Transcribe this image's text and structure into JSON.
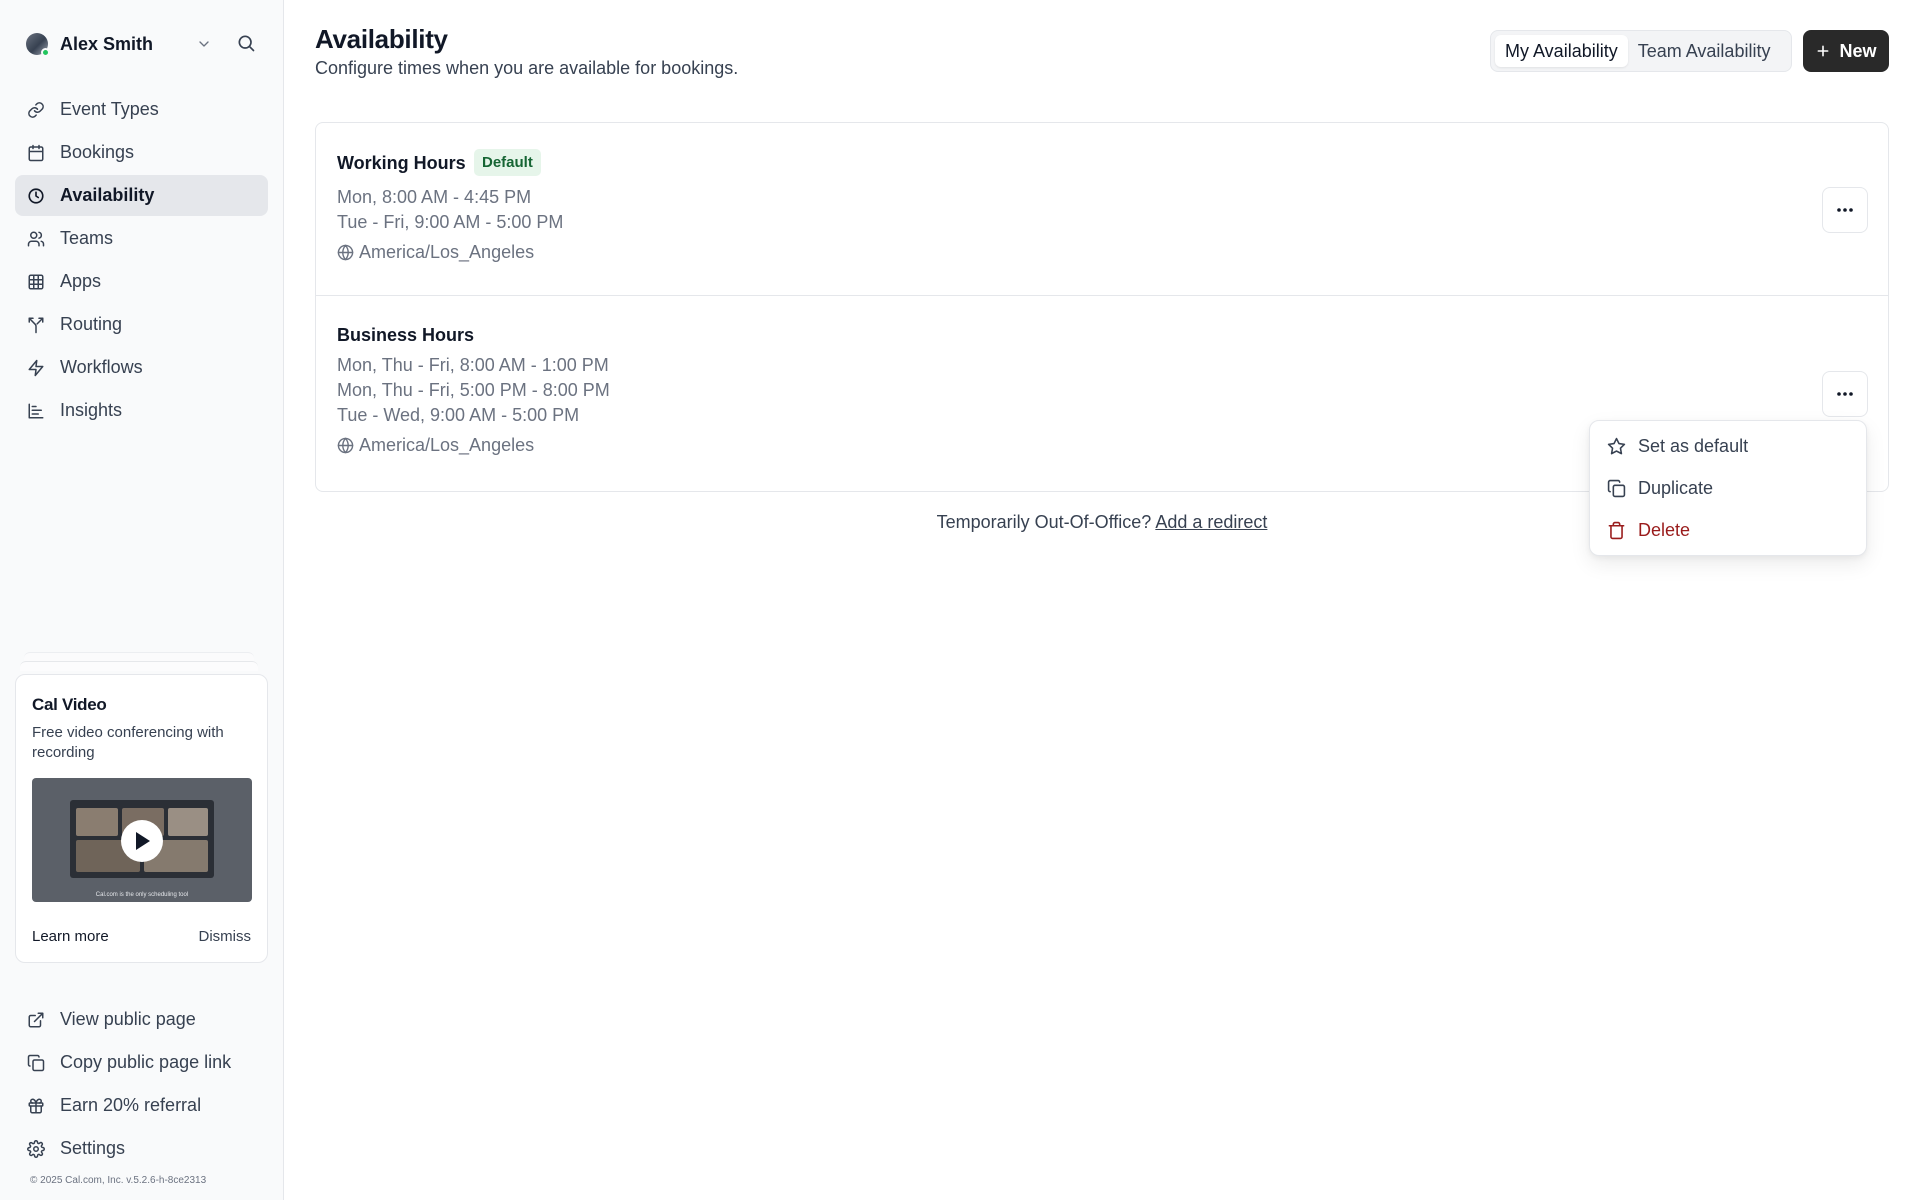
{
  "sidebar": {
    "user": {
      "name": "Alex Smith"
    },
    "nav": [
      {
        "label": "Event Types",
        "icon": "link-icon"
      },
      {
        "label": "Bookings",
        "icon": "calendar-icon"
      },
      {
        "label": "Availability",
        "icon": "clock-icon",
        "active": true
      },
      {
        "label": "Teams",
        "icon": "users-icon"
      },
      {
        "label": "Apps",
        "icon": "grid-icon"
      },
      {
        "label": "Routing",
        "icon": "split-icon"
      },
      {
        "label": "Workflows",
        "icon": "zap-icon"
      },
      {
        "label": "Insights",
        "icon": "bar-chart-icon"
      }
    ],
    "promo": {
      "brand": "Cal Video",
      "description": "Free video conferencing with recording",
      "video_caption": "Cal.com is the only scheduling tool",
      "learn_more": "Learn more",
      "dismiss": "Dismiss"
    },
    "bottom_nav": [
      {
        "label": "View public page",
        "icon": "external-link-icon"
      },
      {
        "label": "Copy public page link",
        "icon": "copy-icon"
      },
      {
        "label": "Earn 20% referral",
        "icon": "gift-icon"
      },
      {
        "label": "Settings",
        "icon": "gear-icon"
      }
    ],
    "copyright": "© 2025 Cal.com, Inc. v.5.2.6-h-8ce2313"
  },
  "header": {
    "title": "Availability",
    "subtitle": "Configure times when you are available for bookings.",
    "toggle": {
      "my": "My Availability",
      "team": "Team Availability",
      "selected": "My Availability"
    },
    "new_label": "New"
  },
  "schedules": [
    {
      "name": "Working Hours",
      "badge": "Default",
      "lines": [
        "Mon, 8:00 AM - 4:45 PM",
        "Tue - Fri, 9:00 AM - 5:00 PM"
      ],
      "timezone": "America/Los_Angeles"
    },
    {
      "name": "Business Hours",
      "lines": [
        "Mon, Thu - Fri, 8:00 AM - 1:00 PM",
        "Mon, Thu - Fri, 5:00 PM - 8:00 PM",
        "Tue - Wed, 9:00 AM - 5:00 PM"
      ],
      "timezone": "America/Los_Angeles"
    }
  ],
  "ooo": {
    "text": "Temporarily Out-Of-Office?",
    "link": "Add a redirect"
  },
  "menu": {
    "items": [
      {
        "label": "Set as default",
        "icon": "star-icon"
      },
      {
        "label": "Duplicate",
        "icon": "copy-icon"
      },
      {
        "label": "Delete",
        "icon": "trash-icon",
        "danger_color": "#991b1b"
      }
    ]
  },
  "colors": {
    "primary_button": "#292929",
    "active_nav": "#e5e7eb",
    "badge_bg": "#e6f5ea",
    "badge_text": "#166534",
    "online": "#22c55e"
  }
}
